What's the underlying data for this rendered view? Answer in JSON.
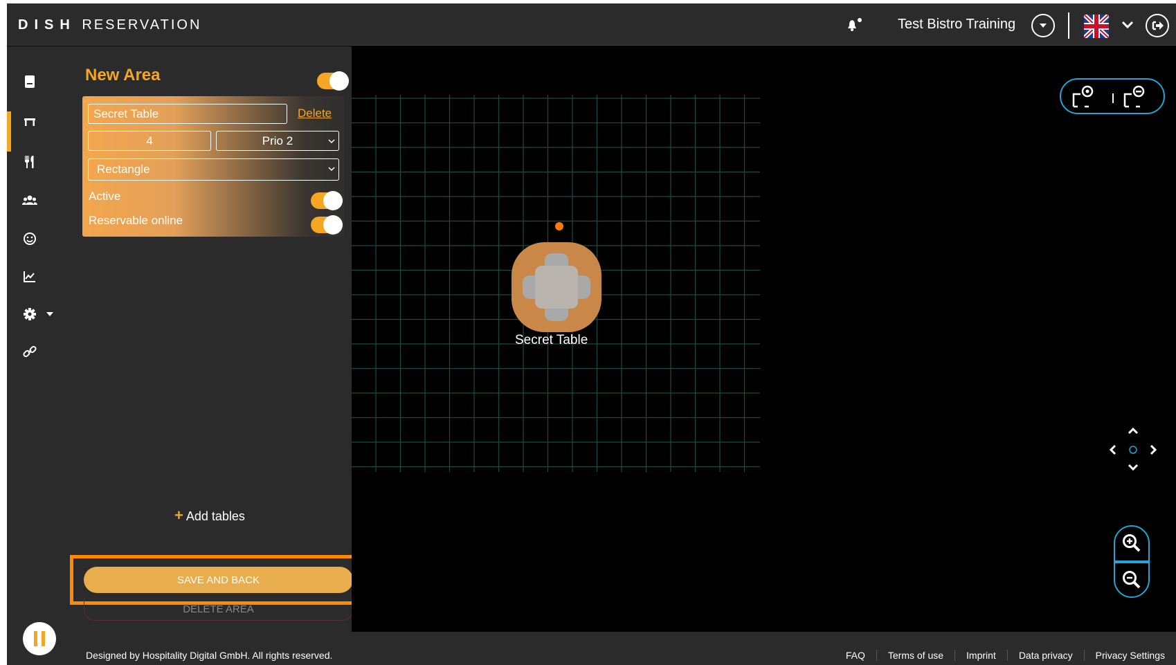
{
  "header": {
    "logo_brand": "DISH",
    "logo_product": "RESERVATION",
    "restaurant_name": "Test Bistro Training",
    "language_icon": "uk-flag-icon"
  },
  "sidebar": {
    "items": [
      {
        "icon": "book-icon"
      },
      {
        "icon": "table-icon",
        "active": true
      },
      {
        "icon": "cutlery-icon"
      },
      {
        "icon": "users-icon"
      },
      {
        "icon": "smile-icon"
      },
      {
        "icon": "chart-icon"
      },
      {
        "icon": "gear-icon"
      },
      {
        "icon": "link-icon"
      }
    ],
    "accent_color": "#f5a623"
  },
  "panel": {
    "title": "New Area",
    "table": {
      "name": "Secret Table",
      "delete_label": "Delete",
      "seats": "4",
      "priority": "Prio 2",
      "shape": "Rectangle",
      "active_label": "Active",
      "online_label": "Reservable online"
    },
    "add_tables_label": "Add tables",
    "save_label": "SAVE AND BACK",
    "delete_area_label": "DELETE AREA"
  },
  "canvas": {
    "table_label": "Secret Table"
  },
  "footer": {
    "copyright": "Designed by Hospitality Digital GmbH. All rights reserved.",
    "links": [
      "FAQ",
      "Terms of use",
      "Imprint",
      "Data privacy",
      "Privacy Settings"
    ]
  }
}
